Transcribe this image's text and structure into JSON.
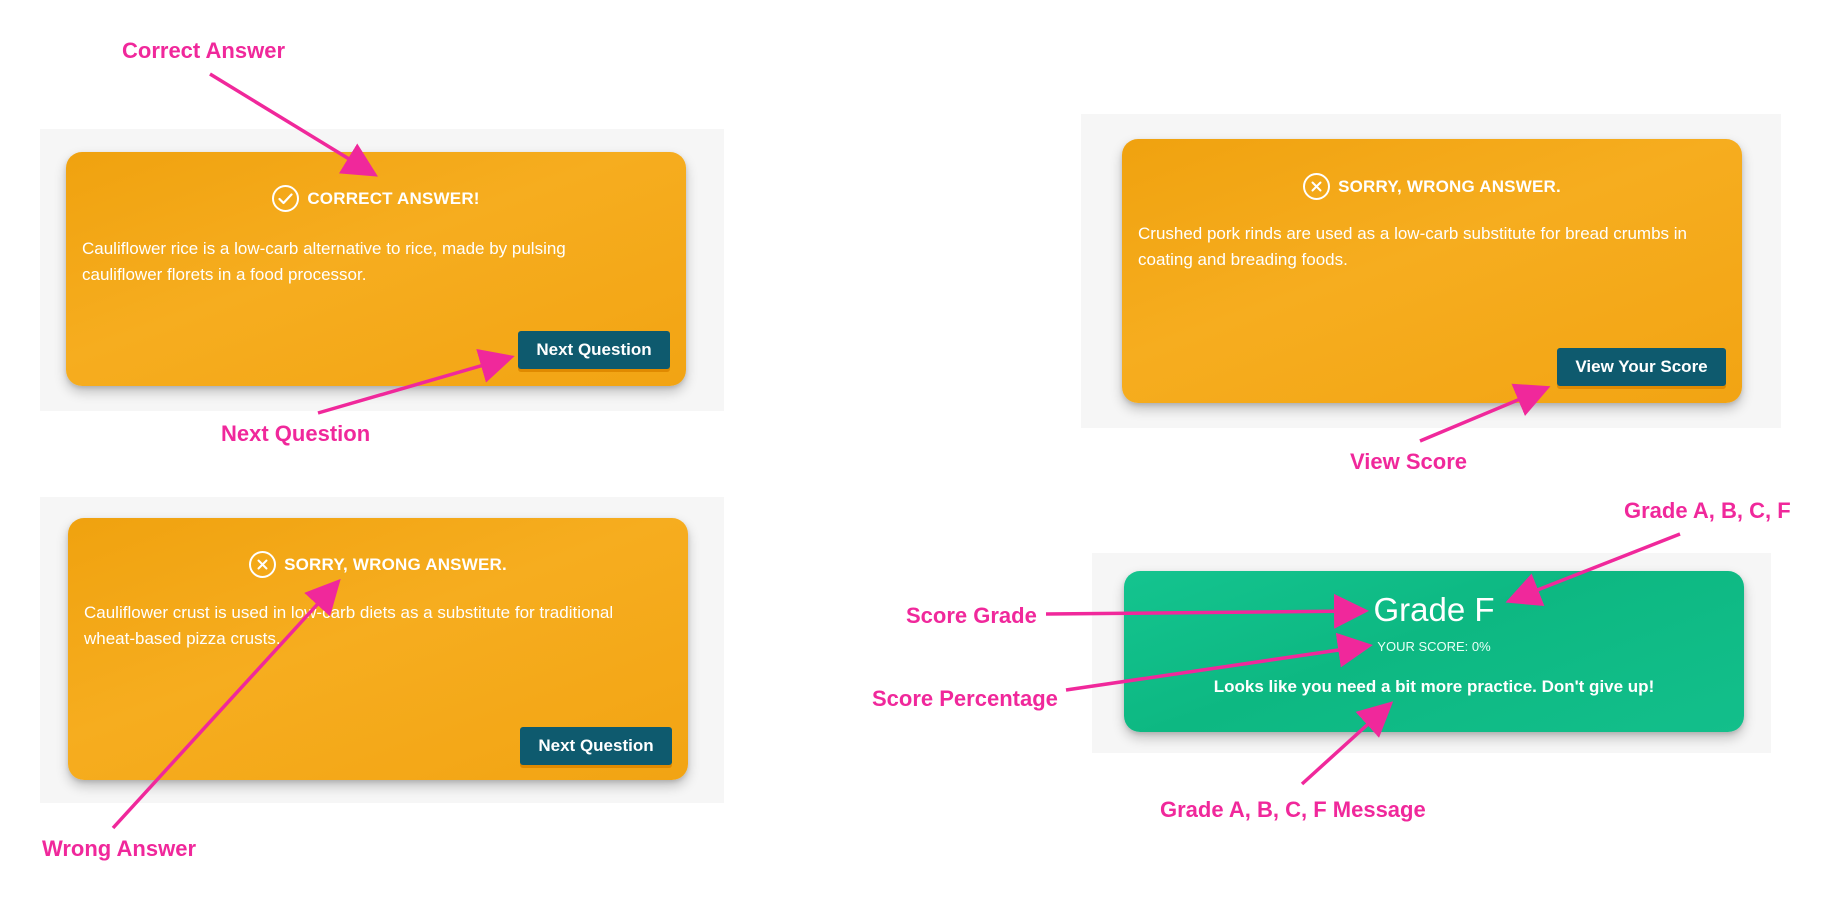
{
  "annotations": {
    "correct_answer": "Correct Answer",
    "next_question": "Next Question",
    "wrong_answer": "Wrong Answer",
    "view_score": "View Score",
    "grade_abcf": "Grade A, B, C, F",
    "score_grade": "Score Grade",
    "score_percentage": "Score Percentage",
    "grade_message": "Grade A, B, C, F Message"
  },
  "card_correct": {
    "heading": "CORRECT ANSWER!",
    "icon": "check-circle-icon",
    "body": "Cauliflower rice is a low-carb alternative to rice, made by pulsing cauliflower florets in a food processor.",
    "button": "Next Question"
  },
  "card_wrong": {
    "heading": "SORRY, WRONG ANSWER.",
    "icon": "x-circle-icon",
    "body": "Cauliflower crust is used in low-carb diets as a substitute for traditional wheat-based pizza crusts.",
    "button": "Next Question"
  },
  "card_wrong_final": {
    "heading": "SORRY, WRONG ANSWER.",
    "icon": "x-circle-icon",
    "body": "Crushed pork rinds are used as a low-carb substitute for bread crumbs in coating and breading foods.",
    "button": "View Your Score"
  },
  "score_card": {
    "grade": "Grade F",
    "score": "YOUR SCORE: 0%",
    "message": "Looks like you need a bit more practice. Don't give up!"
  },
  "colors": {
    "card_orange": "#f4a81a",
    "card_green": "#10bd88",
    "button": "#0e5a6e",
    "annotation": "#f0289b",
    "panel": "#f6f6f6"
  }
}
